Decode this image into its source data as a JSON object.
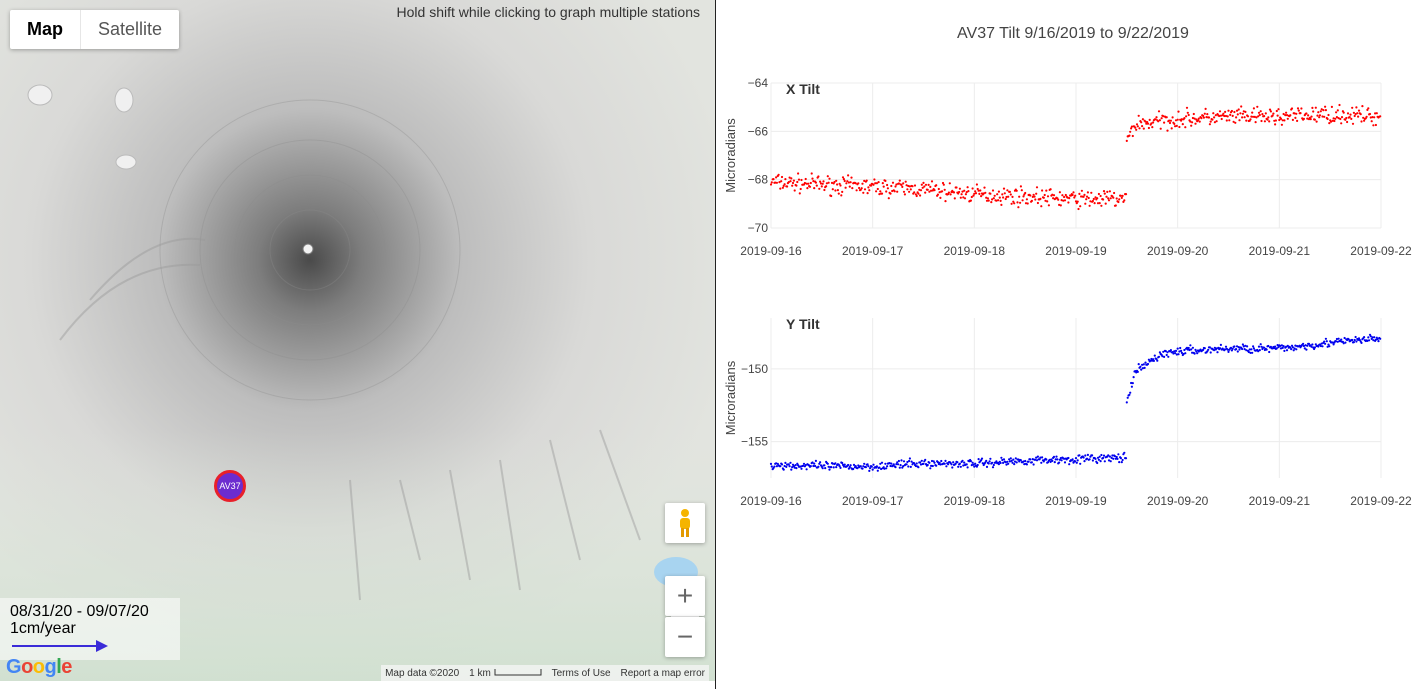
{
  "map": {
    "map_type_buttons": [
      "Map",
      "Satellite"
    ],
    "hint": "Hold shift while clicking to graph multiple stations",
    "station_label": "AV37",
    "legend": {
      "date_range": "08/31/20 - 09/07/20",
      "scale": "1cm/year"
    },
    "google_logo": "Google",
    "footer": {
      "map_data": "Map data ©2020",
      "scale": "1 km",
      "terms": "Terms of Use",
      "report": "Report a map error"
    },
    "controls": {
      "zoom_in": "+",
      "zoom_out": "−",
      "pegman_icon": "pegman-icon"
    },
    "colors": {
      "station_fill": "#6c2ccf",
      "station_border": "#e8202a",
      "legend_arrow": "#3a2bd8"
    }
  },
  "chart_data": {
    "type": "scatter",
    "title": "AV37 Tilt 9/16/2019 to 9/22/2019",
    "panels": [
      {
        "title": "X Tilt",
        "ylabel": "Microradians",
        "ylim": [
          -70,
          -64
        ],
        "yticks": [
          -64,
          -66,
          -68,
          -70
        ],
        "xticks": [
          "2019-09-16",
          "2019-09-17",
          "2019-09-18",
          "2019-09-19",
          "2019-09-20",
          "2019-09-21",
          "2019-09-22"
        ],
        "color": "#ff0000",
        "series": [
          {
            "x": [
              "2019-09-16 00:00",
              "2019-09-16 12:00",
              "2019-09-17 00:00",
              "2019-09-17 12:00",
              "2019-09-18 00:00",
              "2019-09-18 12:00",
              "2019-09-19 00:00",
              "2019-09-19 12:00"
            ],
            "y": [
              -68.1,
              -68.2,
              -68.3,
              -68.4,
              -68.6,
              -68.7,
              -68.8,
              -68.8
            ]
          },
          {
            "x": [
              "2019-09-19 12:00",
              "2019-09-19 14:00",
              "2019-09-20 00:00",
              "2019-09-20 12:00",
              "2019-09-21 00:00",
              "2019-09-21 12:00",
              "2019-09-22 00:00"
            ],
            "y": [
              -66.4,
              -65.7,
              -65.5,
              -65.4,
              -65.4,
              -65.3,
              -65.4
            ]
          }
        ]
      },
      {
        "title": "Y Tilt",
        "ylabel": "Microradians",
        "ylim": [
          -157.5,
          -146.5
        ],
        "yticks": [
          -150,
          -155
        ],
        "xticks": [
          "2019-09-16",
          "2019-09-17",
          "2019-09-18",
          "2019-09-19",
          "2019-09-20",
          "2019-09-21",
          "2019-09-22"
        ],
        "color": "#0000ee",
        "series": [
          {
            "x": [
              "2019-09-16 00:00",
              "2019-09-16 12:00",
              "2019-09-17 00:00",
              "2019-09-17 12:00",
              "2019-09-18 00:00",
              "2019-09-18 12:00",
              "2019-09-19 00:00",
              "2019-09-19 12:00"
            ],
            "y": [
              -156.6,
              -156.7,
              -156.7,
              -156.5,
              -156.5,
              -156.3,
              -156.2,
              -156.1
            ]
          },
          {
            "x": [
              "2019-09-19 12:00",
              "2019-09-19 14:00",
              "2019-09-19 20:00",
              "2019-09-20 00:00",
              "2019-09-20 12:00",
              "2019-09-21 00:00",
              "2019-09-21 12:00",
              "2019-09-22 00:00"
            ],
            "y": [
              -152.4,
              -150.2,
              -149.0,
              -148.8,
              -148.6,
              -148.6,
              -148.2,
              -147.9
            ]
          }
        ]
      }
    ]
  }
}
